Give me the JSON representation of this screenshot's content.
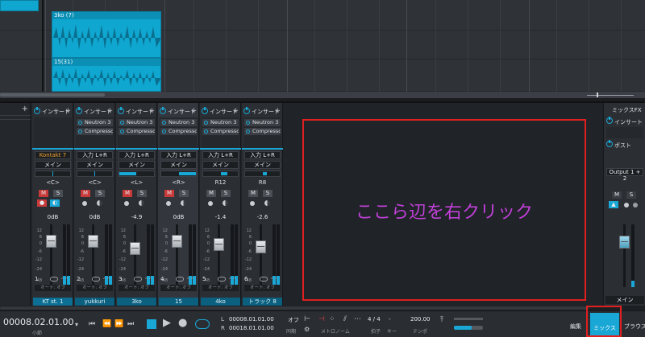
{
  "arrange": {
    "clips": [
      {
        "label": "3ko (7)"
      },
      {
        "label": "15(31)"
      }
    ]
  },
  "mixer": {
    "instruction": "ここら辺を右クリック",
    "channels": [
      {
        "insert_label": "インサート",
        "plugins": [],
        "input": "Kontakt 7",
        "output": "メイン",
        "pan": "<C>",
        "db": "0dB",
        "num": "1",
        "auto": "オート: オフ",
        "name": "KT st. 1"
      },
      {
        "insert_label": "インサート",
        "plugins": [
          "Neutron 3",
          "Compressor"
        ],
        "input": "入力 L+R",
        "output": "メイン",
        "pan": "<C>",
        "db": "0dB",
        "num": "2",
        "auto": "オート: オフ",
        "name": "yukkuri"
      },
      {
        "insert_label": "インサート",
        "plugins": [
          "Neutron 3",
          "Compressor"
        ],
        "input": "入力 L+R",
        "output": "メイン",
        "pan": "<L>",
        "db": "-4.9",
        "num": "3",
        "auto": "オート: オフ",
        "name": "3ko"
      },
      {
        "insert_label": "インサート",
        "plugins": [
          "Neutron 3",
          "Compressor"
        ],
        "input": "入力 L+R",
        "output": "メイン",
        "pan": "<R>",
        "db": "0dB",
        "num": "4",
        "auto": "オート: オフ",
        "name": "15"
      },
      {
        "insert_label": "インサート",
        "plugins": [
          "Neutron 3",
          "Compressor"
        ],
        "input": "入力 L+R",
        "output": "メイン",
        "pan": "R12",
        "db": "-1.4",
        "num": "5",
        "auto": "オート: オフ",
        "name": "4ko"
      },
      {
        "insert_label": "インサート",
        "plugins": [
          "Neutron 3",
          "Compressor"
        ],
        "input": "入力 L+R",
        "output": "メイン",
        "pan": "R8",
        "db": "-2.6",
        "num": "6",
        "auto": "オート: オフ",
        "name": "トラック 8"
      }
    ],
    "main": {
      "fx_label": "ミックスFX",
      "insert_label": "インサート",
      "post_label": "ポスト",
      "output": "Output 1 + 2",
      "name": "メイン"
    },
    "buttons": {
      "mute": "M",
      "solo": "S"
    },
    "scale": [
      "12",
      "6",
      "0",
      "-6",
      "-12",
      "-24",
      "-48"
    ]
  },
  "transport": {
    "time": "00008.02.01.00",
    "time_unit": "小節",
    "loop_l": "00008.01.01.00",
    "loop_r": "00018.01.01.00",
    "metronome_off": "オフ",
    "sync": "同期",
    "metronome": "メトロノーム",
    "signature": "4 / 4",
    "signature_label": "拍子",
    "key_label": "キー",
    "tempo": "200.00",
    "tempo_label": "テンポ",
    "tabs": {
      "edit": "編集",
      "mix": "ミックス",
      "browse": "ブラウズ"
    }
  },
  "colors": {
    "accent": "#19a7d6",
    "highlight": "#e02020",
    "instruction": "#c040d8"
  }
}
